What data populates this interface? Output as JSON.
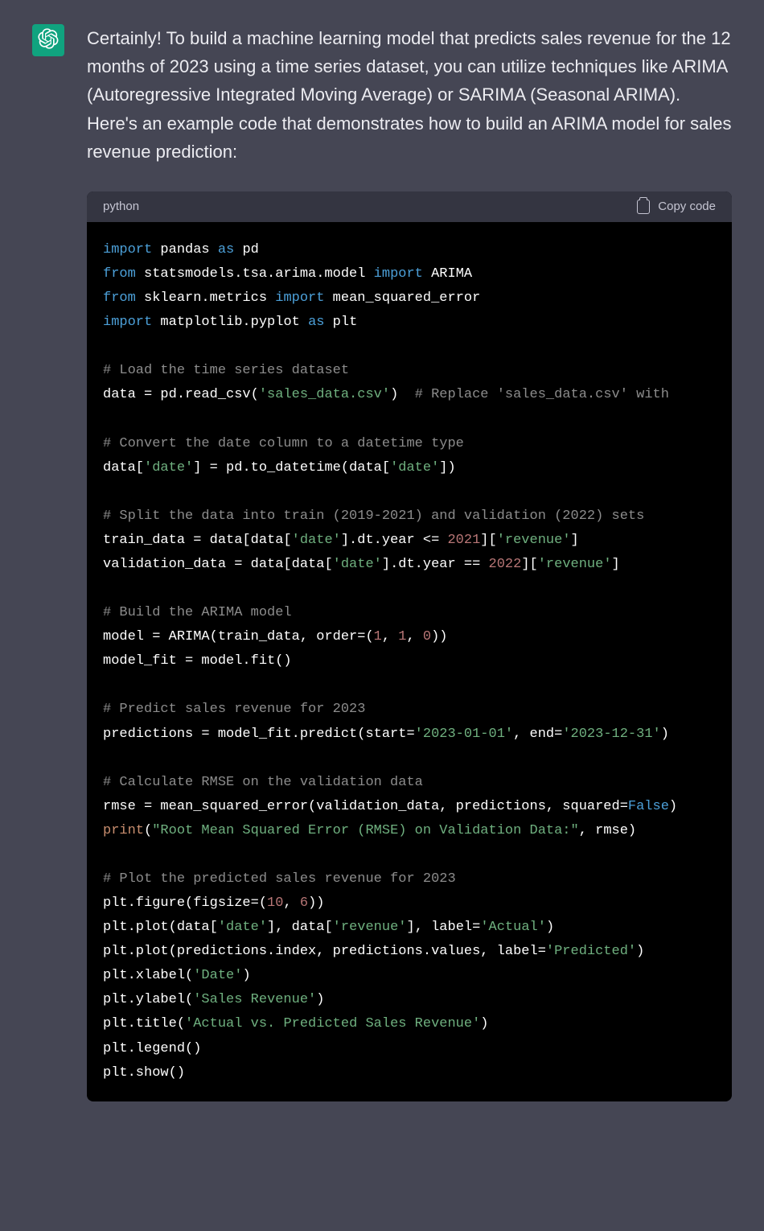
{
  "message": {
    "intro": "Certainly! To build a machine learning model that predicts sales revenue for the 12 months of 2023 using a time series dataset, you can utilize techniques like ARIMA (Autoregressive Integrated Moving Average) or SARIMA (Seasonal ARIMA). Here's an example code that demonstrates how to build an ARIMA model for sales revenue prediction:"
  },
  "codeblock": {
    "language": "python",
    "copy_label": "Copy code",
    "lines": {
      "l1_kw1": "import",
      "l1_t1": " pandas ",
      "l1_kw2": "as",
      "l1_t2": " pd",
      "l2_kw1": "from",
      "l2_t1": " statsmodels.tsa.arima.model ",
      "l2_kw2": "import",
      "l2_t2": " ARIMA",
      "l3_kw1": "from",
      "l3_t1": " sklearn.metrics ",
      "l3_kw2": "import",
      "l3_t2": " mean_squared_error",
      "l4_kw1": "import",
      "l4_t1": " matplotlib.pyplot ",
      "l4_kw2": "as",
      "l4_t2": " plt",
      "l5_c": "# Load the time series dataset",
      "l6_t1": "data = pd.read_csv(",
      "l6_s1": "'sales_data.csv'",
      "l6_t2": ")  ",
      "l6_c1": "# Replace 'sales_data.csv' with",
      "l7_c": "# Convert the date column to a datetime type",
      "l8_t1": "data[",
      "l8_s1": "'date'",
      "l8_t2": "] = pd.to_datetime(data[",
      "l8_s2": "'date'",
      "l8_t3": "])",
      "l9_c": "# Split the data into train (2019-2021) and validation (2022) sets",
      "l10_t1": "train_data = data[data[",
      "l10_s1": "'date'",
      "l10_t2": "].dt.year <= ",
      "l10_n1": "2021",
      "l10_t3": "][",
      "l10_s2": "'revenue'",
      "l10_t4": "]",
      "l11_t1": "validation_data = data[data[",
      "l11_s1": "'date'",
      "l11_t2": "].dt.year == ",
      "l11_n1": "2022",
      "l11_t3": "][",
      "l11_s2": "'revenue'",
      "l11_t4": "]",
      "l12_c": "# Build the ARIMA model",
      "l13_t1": "model = ARIMA(train_data, order=(",
      "l13_n1": "1",
      "l13_t2": ", ",
      "l13_n2": "1",
      "l13_t3": ", ",
      "l13_n3": "0",
      "l13_t4": "))",
      "l14_t1": "model_fit = model.fit()",
      "l15_c": "# Predict sales revenue for 2023",
      "l16_t1": "predictions = model_fit.predict(start=",
      "l16_s1": "'2023-01-01'",
      "l16_t2": ", end=",
      "l16_s2": "'2023-12-31'",
      "l16_t3": ")",
      "l17_c": "# Calculate RMSE on the validation data",
      "l18_t1": "rmse = mean_squared_error(validation_data, predictions, squared=",
      "l18_b1": "False",
      "l18_t2": ")",
      "l19_fn": "print",
      "l19_t1": "(",
      "l19_s1": "\"Root Mean Squared Error (RMSE) on Validation Data:\"",
      "l19_t2": ", rmse)",
      "l20_c": "# Plot the predicted sales revenue for 2023",
      "l21_t1": "plt.figure(figsize=(",
      "l21_n1": "10",
      "l21_t2": ", ",
      "l21_n2": "6",
      "l21_t3": "))",
      "l22_t1": "plt.plot(data[",
      "l22_s1": "'date'",
      "l22_t2": "], data[",
      "l22_s2": "'revenue'",
      "l22_t3": "], label=",
      "l22_s3": "'Actual'",
      "l22_t4": ")",
      "l23_t1": "plt.plot(predictions.index, predictions.values, label=",
      "l23_s1": "'Predicted'",
      "l23_t2": ")",
      "l24_t1": "plt.xlabel(",
      "l24_s1": "'Date'",
      "l24_t2": ")",
      "l25_t1": "plt.ylabel(",
      "l25_s1": "'Sales Revenue'",
      "l25_t2": ")",
      "l26_t1": "plt.title(",
      "l26_s1": "'Actual vs. Predicted Sales Revenue'",
      "l26_t2": ")",
      "l27_t1": "plt.legend()",
      "l28_t1": "plt.show()"
    }
  }
}
